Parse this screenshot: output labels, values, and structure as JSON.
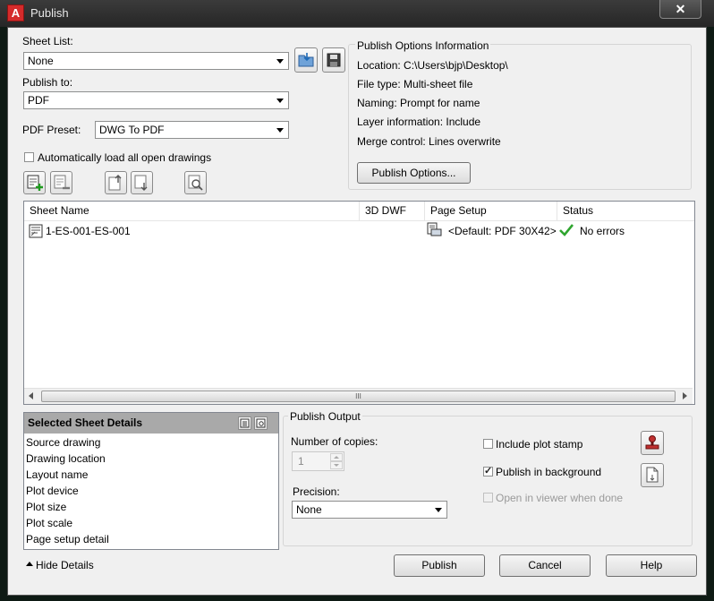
{
  "window": {
    "title": "Publish",
    "app_icon_letter": "A",
    "close_glyph": "✕"
  },
  "sheet_list": {
    "label": "Sheet List:",
    "value": "None"
  },
  "publish_to": {
    "label": "Publish to:",
    "value": "PDF"
  },
  "pdf_preset": {
    "label": "PDF Preset:",
    "value": "DWG To PDF"
  },
  "auto_load": {
    "label": "Automatically load all open drawings",
    "checked": false
  },
  "options_info": {
    "title": "Publish Options Information",
    "location": "Location:  C:\\Users\\bjp\\Desktop\\",
    "file_type": "File type:  Multi-sheet file",
    "naming": "Naming:  Prompt for name",
    "layer_info": "Layer information:  Include",
    "merge_control": "Merge control:  Lines overwrite",
    "button": "Publish Options..."
  },
  "table": {
    "columns": [
      "Sheet Name",
      "3D DWF",
      "Page Setup",
      "Status"
    ],
    "rows": [
      {
        "sheet_name": "1-ES-001-ES-001",
        "dwf": "",
        "page_setup": "<Default: PDF 30X42>",
        "status": "No errors"
      }
    ],
    "scroll_grip": "III"
  },
  "selected_details": {
    "title": "Selected Sheet Details",
    "rows": [
      "Source drawing",
      "Drawing location",
      "Layout name",
      "Plot device",
      "Plot size",
      "Plot scale",
      "Page setup detail"
    ]
  },
  "publish_output": {
    "title": "Publish Output",
    "copies_label": "Number of copies:",
    "copies_value": "1",
    "precision_label": "Precision:",
    "precision_value": "None",
    "plot_stamp_label": "Include plot stamp",
    "plot_stamp_checked": false,
    "background_label": "Publish in background",
    "background_checked": true,
    "open_viewer_label": "Open in viewer when done",
    "open_viewer_checked": false
  },
  "footer": {
    "hide_details": "Hide Details",
    "publish": "Publish",
    "cancel": "Cancel",
    "help": "Help"
  },
  "colors": {
    "titlebar": "#2e2e2e",
    "dialog": "#f0f0f0",
    "status_ok": "#2fa52f",
    "details_header": "#a9a9a9"
  }
}
